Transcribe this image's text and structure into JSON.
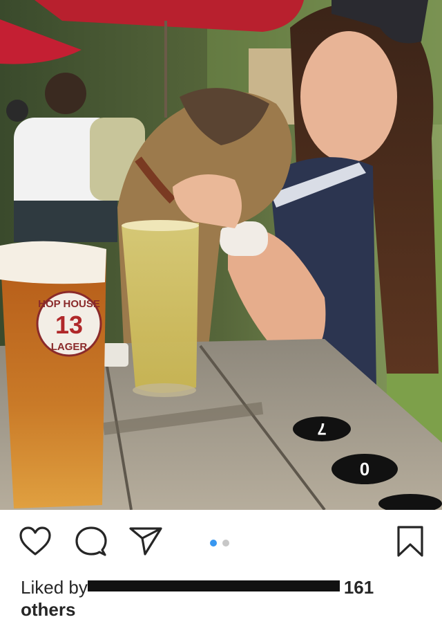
{
  "post": {
    "photo_alt_icon": "post-photo",
    "glass_logo": {
      "line1": "HOP HOUSE",
      "number": "13",
      "line2": "LAGER"
    },
    "table_numbers": [
      "7",
      "0"
    ]
  },
  "actions": {
    "like_icon": "heart-icon",
    "comment_icon": "comment-icon",
    "share_icon": "send-icon",
    "save_icon": "bookmark-icon",
    "carousel": {
      "count": 2,
      "active_index": 0
    }
  },
  "likes": {
    "prefix": "Liked by",
    "suffix_count": "161",
    "others_label": "others"
  },
  "colors": {
    "accent_blue": "#3897f0",
    "dot_inactive": "#c7c7c7",
    "text": "#262626"
  }
}
